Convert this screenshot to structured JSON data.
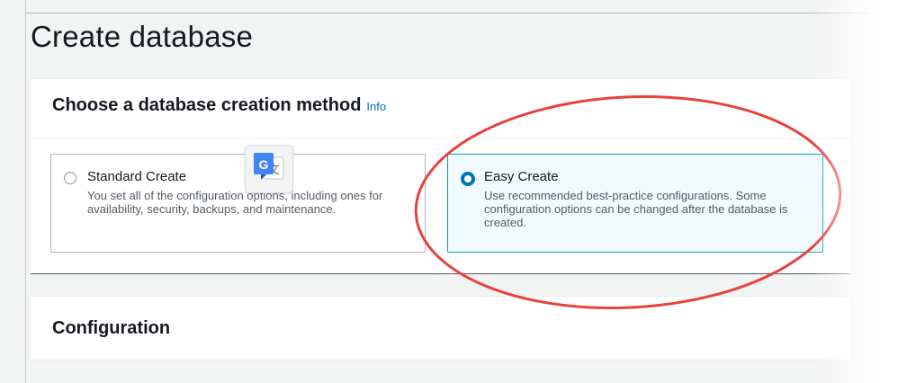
{
  "page": {
    "title": "Create database"
  },
  "creation_method": {
    "title": "Choose a database creation method",
    "info_link": "Info",
    "options": [
      {
        "title": "Standard Create",
        "description": "You set all of the configuration options, including ones for availability, security, backups, and maintenance.",
        "selected": false
      },
      {
        "title": "Easy Create",
        "description": "Use recommended best-practice configurations. Some configuration options can be changed after the database is created.",
        "selected": true
      }
    ]
  },
  "configuration": {
    "title": "Configuration"
  },
  "overlay": {
    "translate_icon": "google-translate-icon",
    "highlight_color": "#e8413d"
  },
  "colors": {
    "accent": "#0073bb",
    "selected_tile_bg": "#f1faff",
    "selected_tile_border": "#00a1c9"
  }
}
